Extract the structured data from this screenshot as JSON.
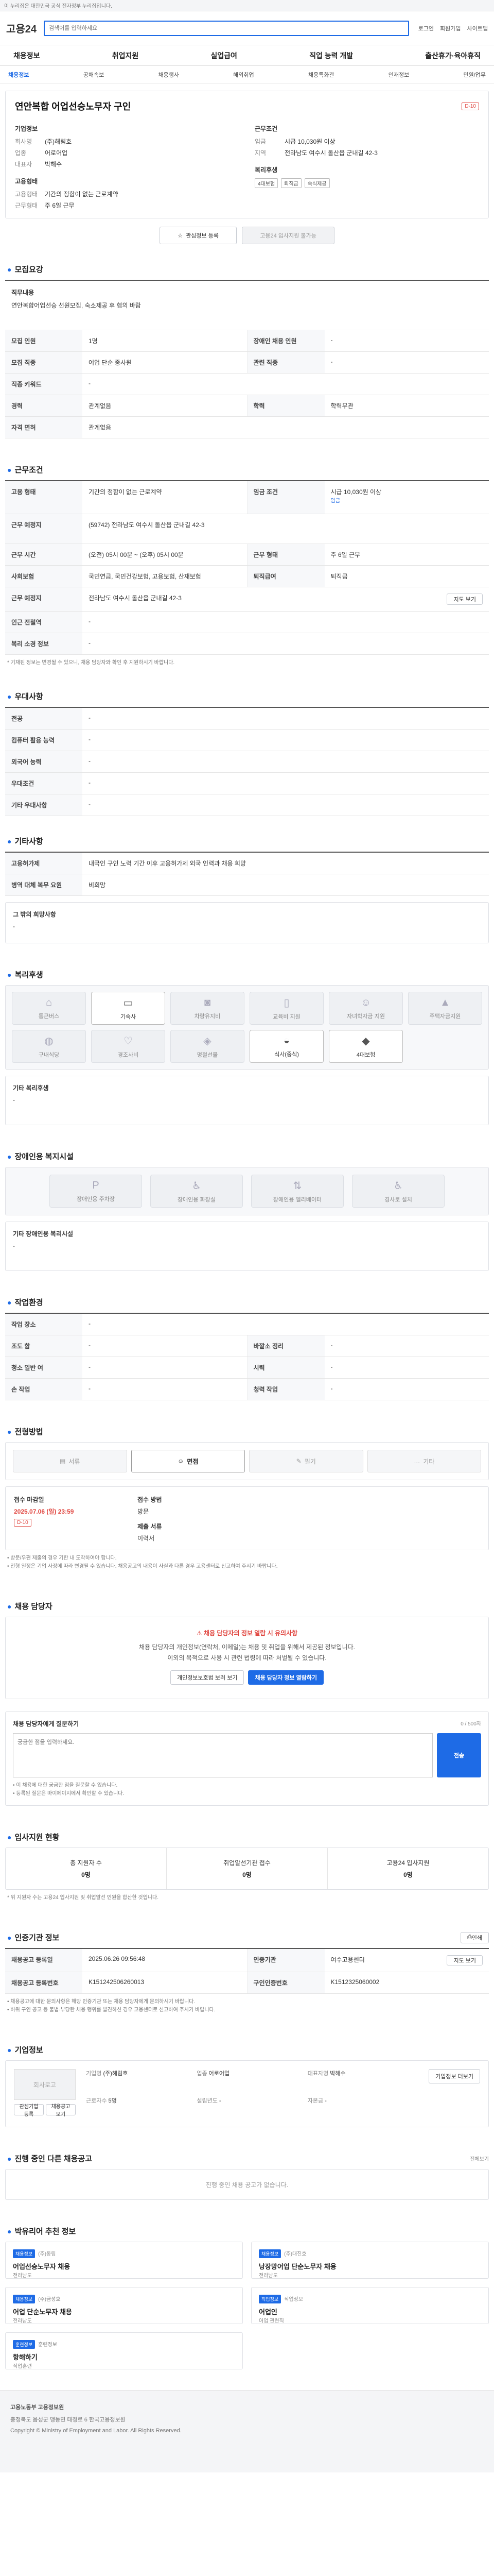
{
  "topbar": {
    "notice": "이 누리집은 대한민국 공식 전자정부 누리집입니다."
  },
  "header": {
    "logo_main": "고용24",
    "search_placeholder": "검색어를 입력하세요",
    "links": [
      "로그인",
      "회원가입",
      "사이트맵"
    ]
  },
  "gnb": [
    "채용정보",
    "취업지원",
    "실업급여",
    "직업 능력 개발",
    "출산휴가·육아휴직"
  ],
  "subnav": [
    "채용정보",
    "공채속보",
    "채용행사",
    "해외취업",
    "채용특화관",
    "인재정보",
    "민원/업무"
  ],
  "job": {
    "title": "연안복합 어업선승노무자 구인",
    "dday": "D-10",
    "company_label": "기업정보",
    "company_rows": [
      {
        "k": "회사명",
        "v": "(주)해림호"
      },
      {
        "k": "업종",
        "v": "어로어업"
      },
      {
        "k": "대표자",
        "v": "박해수"
      }
    ],
    "cond_label": "근무조건",
    "cond_rows": [
      {
        "k": "임금",
        "v": "시급 10,030원 이상"
      },
      {
        "k": "지역",
        "v": "전라남도 여수시 돌산읍 군내길 42-3"
      }
    ],
    "type_label": "고용형태",
    "type_rows": [
      {
        "k": "고용형태",
        "v": "기간의 정함이 없는 근로계약"
      },
      {
        "k": "근무형태",
        "v": "주 6일 근무"
      }
    ],
    "welfare_label": "복리후생",
    "welfare_tags": [
      "4대보험",
      "퇴직금",
      "숙식제공"
    ],
    "btn_interest": "관심정보 등록",
    "btn_apply": "고용24 입사지원 불가능"
  },
  "recruit": {
    "title": "모집요강",
    "duty_title": "직무내용",
    "duty_text": "연안복합어업선승 선원모집, 숙소제공 후 협의 바람",
    "rows": [
      [
        {
          "k": "모집 인원",
          "v": "1명"
        },
        {
          "k": "장애인 채용 인원",
          "v": "-"
        }
      ],
      [
        {
          "k": "모집 직종",
          "v": "어업 단순 종사원"
        },
        {
          "k": "관련 직종",
          "v": "-"
        }
      ],
      [
        {
          "k": "직종 키워드",
          "v": "-"
        }
      ],
      [
        {
          "k": "경력",
          "v": "관계없음"
        },
        {
          "k": "학력",
          "v": "학력무관"
        }
      ],
      [
        {
          "k": "자격 면허",
          "v": "관계없음"
        }
      ]
    ]
  },
  "work": {
    "title": "근무조건",
    "rows": [
      [
        {
          "k": "고용 형태",
          "v": "기간의 정함이 없는 근로계약"
        },
        {
          "k": "임금 조건",
          "v": "시급 10,030원 이상"
        }
      ],
      [
        {
          "k": "근무 예정지",
          "v": "(59742) 전라남도 여수시 돌산읍 군내길 42-3"
        }
      ],
      [
        {
          "k": "근무 시간",
          "v": "(오전) 05시 00분 ~ (오후) 05시 00분"
        },
        {
          "k": "근무 형태",
          "v": "주 6일 근무"
        }
      ],
      [
        {
          "k": "사회보험",
          "v": "국민연금, 국민건강보험, 고용보험, 산재보험"
        },
        {
          "k": "퇴직급여",
          "v": "퇴직금"
        }
      ],
      [
        {
          "k": "근무 예정지",
          "v": "전라남도 여수시 돌산읍 군내길 42-3"
        }
      ],
      [
        {
          "k": "인근 전철역",
          "v": "-"
        }
      ],
      [
        {
          "k": "복리 소경 정보",
          "v": "-"
        }
      ]
    ],
    "wage_link": "임금",
    "map_button": "지도 보기",
    "note": "* 기재된 정보는 변경될 수 있으니, 채용 담당자와 확인 후 지원하시기 바랍니다."
  },
  "pref": {
    "title": "우대사항",
    "rows": [
      [
        {
          "k": "전공",
          "v": "-"
        }
      ],
      [
        {
          "k": "컴퓨터 활용 능력",
          "v": "-"
        }
      ],
      [
        {
          "k": "외국어 능력",
          "v": "-"
        }
      ],
      [
        {
          "k": "우대조건",
          "v": "-"
        }
      ],
      [
        {
          "k": "기타 우대사항",
          "v": "-"
        }
      ]
    ]
  },
  "etc": {
    "title": "기타사항",
    "rows": [
      [
        {
          "k": "고용허가제",
          "v": "내국인 구인 노력 기간 이후 고용허가제 외국 인력과 채용 희망"
        }
      ],
      [
        {
          "k": "병역 대체 복무 요원",
          "v": "비희망"
        }
      ]
    ],
    "extra_label": "그 밖의 희망사항",
    "extra_value": "-"
  },
  "welfare": {
    "title": "복리후생",
    "items": [
      {
        "icon": "house-icon",
        "label": "통근버스",
        "on": false
      },
      {
        "icon": "bed-icon",
        "label": "기숙사",
        "on": true
      },
      {
        "icon": "car-icon",
        "label": "차량유지비",
        "on": false
      },
      {
        "icon": "book-icon",
        "label": "교육비 지원",
        "on": false
      },
      {
        "icon": "child-icon",
        "label": "자녀학자금 지원",
        "on": false
      },
      {
        "icon": "cap-icon",
        "label": "주택자금지원",
        "on": false
      },
      {
        "icon": "meal-icon",
        "label": "구내식당",
        "on": false
      },
      {
        "icon": "heart-icon",
        "label": "경조사비",
        "on": false
      },
      {
        "icon": "gift-icon",
        "label": "명절선물",
        "on": false
      },
      {
        "icon": "bowl-icon",
        "label": "식사(중식)",
        "on": true
      },
      {
        "icon": "shield-icon",
        "label": "4대보험",
        "on": true
      }
    ],
    "extra_label": "기타 복리후생",
    "extra_value": "-"
  },
  "disabled": {
    "title": "장애인용 복지시설",
    "items": [
      {
        "icon": "parking-icon",
        "label": "장애인용 주차장"
      },
      {
        "icon": "toilet-icon",
        "label": "장애인용 화장실"
      },
      {
        "icon": "elevator-icon",
        "label": "장애인용 엘리베이터"
      },
      {
        "icon": "wheelchair-icon",
        "label": "경사로 설치"
      }
    ],
    "extra_label": "기타 장애인용 복리시설",
    "extra_value": "-"
  },
  "env": {
    "title": "작업환경",
    "rows": [
      [
        {
          "k": "작업 장소",
          "v": "-"
        }
      ],
      [
        {
          "k": "조도 함",
          "v": "-"
        },
        {
          "k": "바깥소 정리",
          "v": "-"
        }
      ],
      [
        {
          "k": "청소 일반 여",
          "v": "-"
        },
        {
          "k": "시력",
          "v": "-"
        }
      ],
      [
        {
          "k": "손 작업",
          "v": "-"
        },
        {
          "k": "청력 작업",
          "v": "-"
        }
      ]
    ]
  },
  "process": {
    "title": "전형방법",
    "steps": [
      "서류",
      "면접",
      "필기",
      "기타"
    ],
    "active": 1,
    "deadline_label": "접수 마감일",
    "deadline_value": "2025.07.06 (일) 23:59",
    "dday": "D-10",
    "method_label": "접수 방법",
    "method_value": "방문",
    "doc_label": "제출 서류",
    "doc_value": "이력서",
    "notes": [
      "• 방문/우편 제출의 경우 기한 내 도착하여야 합니다.",
      "• 전형 일정은 기업 사정에 따라 변경될 수 있습니다. 채용공고의 내용이 사실과 다른 경우 고용센터로 신고하여 주시기 바랍니다."
    ]
  },
  "manager": {
    "title": "채용 담당자",
    "alert": "채용 담당자의 정보 열람 시 유의사항",
    "desc1": "채용 담당자의 개인정보(연락처, 이메일)는 채용 및 취업을 위해서 제공된 정보입니다.",
    "desc2": "이외의 목적으로 사용 시 관련 법령에 따라 처벌될 수 있습니다.",
    "btn_terms": "개인정보보호법 보러 보기",
    "btn_view": "채용 담당자 정보 열람하기"
  },
  "inquiry": {
    "title": "채용 담당자에게 질문하기",
    "counter": "0 / 500자",
    "placeholder": "궁금한 점을 입력하세요.",
    "submit": "전송",
    "note1": "• 이 채용에 대한 궁금한 점을 질문할 수 있습니다.",
    "note2": "• 등록된 질문은 마이페이지에서 확인할 수 있습니다."
  },
  "stats": {
    "title": "입사지원 현황",
    "items": [
      {
        "label": "총 지원자 수",
        "value": "0명"
      },
      {
        "label": "취업알선기관 접수",
        "value": "0명"
      },
      {
        "label": "고용24 입사지원",
        "value": "0명"
      }
    ],
    "note": "* 위 지원자 수는 고용24 입사지원 및 취업알선 인원을 합산한 것입니다."
  },
  "agency": {
    "title": "인증기관 정보",
    "print_btn": "인쇄",
    "rows": [
      [
        {
          "k": "채용공고 등록일",
          "v": "2025.06.26 09:56:48"
        },
        {
          "k": "인증기관",
          "v": "여수고용센터"
        }
      ],
      [
        {
          "k": "채용공고 등록번호",
          "v": "K151242506260013"
        },
        {
          "k": "구인인증번호",
          "v": "K1512325060002"
        }
      ]
    ],
    "map_btn": "지도 보기",
    "notes": [
      "• 채용공고에 대한 문의사항은 해당 인증기관 또는 채용 담당자에게 문의하시기 바랍니다.",
      "• 허위 구인 공고 등 불법·부당한 채용 행위를 발견하신 경우 고용센터로 신고하여 주시기 바랍니다."
    ]
  },
  "corp": {
    "title": "기업정보",
    "logo_alt": "회사로고",
    "fields": [
      {
        "k": "기업명",
        "v": "(주)해림호"
      },
      {
        "k": "업종",
        "v": "어로어업"
      },
      {
        "k": "대표자명",
        "v": "박해수"
      },
      {
        "k": "근로자수",
        "v": "5명"
      },
      {
        "k": "설립년도",
        "v": "-"
      },
      {
        "k": "자본금",
        "v": "-"
      }
    ],
    "btn_more": "기업정보 더보기",
    "btn_interest": "관심기업 등록",
    "btn_other": "채용공고 보기"
  },
  "other_jobs": {
    "title": "진행 중인 다른 채용공고",
    "more": "전체보기",
    "empty": "진행 중인 채용 공고가 없습니다."
  },
  "recommend": {
    "title": "박유리어 추천 정보",
    "cards": [
      {
        "badge": "채용정보",
        "org": "(주)동림",
        "title": "어업선승노무자 채용",
        "meta": "전라남도"
      },
      {
        "badge": "채용정보",
        "org": "(주)대진호",
        "title": "낭장망어업 단순노무자 채용",
        "meta": "전라남도"
      },
      {
        "badge": "채용정보",
        "org": "(주)금성호",
        "title": "어업 단순노무자 채용",
        "meta": "전라남도"
      },
      {
        "badge": "직업정보",
        "org": "직업정보",
        "title": "어업인",
        "meta": "어업 관련직"
      },
      {
        "badge": "훈련정보",
        "org": "훈련정보",
        "title": "항해하기",
        "meta": "직업훈련"
      }
    ]
  },
  "footer": {
    "org": "고용노동부 고용정보원",
    "addr": "충청북도 음성군 맹동면 태정로 6 한국고용정보원",
    "copy": "Copyright © Ministry of Employment and Labor. All Rights Reserved."
  }
}
